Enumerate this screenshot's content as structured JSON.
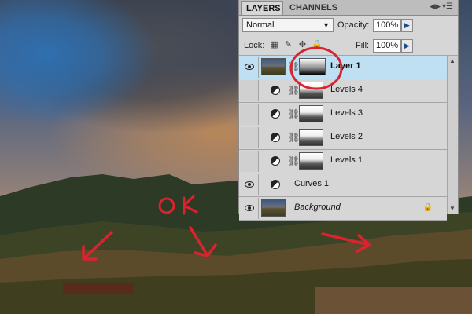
{
  "tabs": {
    "layers": "LAYERS",
    "channels": "CHANNELS"
  },
  "panel_menu_icon": "panel-menu-icon",
  "blend_mode": "Normal",
  "opacity": {
    "label": "Opacity:",
    "value": "100%"
  },
  "fill": {
    "label": "Fill:",
    "value": "100%"
  },
  "lock_label": "Lock:",
  "layers": [
    {
      "name": "Layer 1",
      "visible": true,
      "selected": true
    },
    {
      "name": "Levels 4",
      "visible": false
    },
    {
      "name": "Levels 3",
      "visible": false
    },
    {
      "name": "Levels 2",
      "visible": false
    },
    {
      "name": "Levels 1",
      "visible": false
    },
    {
      "name": "Curves 1",
      "visible": true
    },
    {
      "name": "Background",
      "visible": true,
      "locked": true
    }
  ],
  "annotation": {
    "text": "OK",
    "color": "#d9232e"
  }
}
